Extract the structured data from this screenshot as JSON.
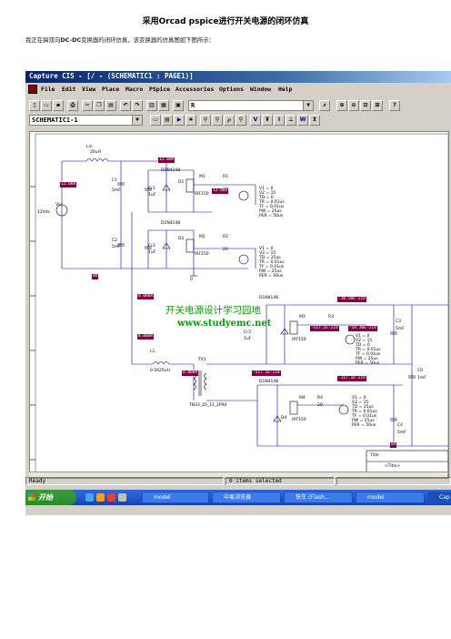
{
  "document": {
    "title": "采用Orcad pspice进行开关电源的闭环仿真",
    "intro_prefix": "我正在搞双向",
    "intro_bold": "DC-DC",
    "intro_suffix": "变换器的闭环仿真，该变换器的仿真图如下图所示："
  },
  "window": {
    "title": "Capture CIS - [/ - (SCHEMATIC1 : PAGE1)]"
  },
  "menu": [
    "File",
    "Edit",
    "View",
    "Place",
    "Macro",
    "PSpice",
    "Accessories",
    "Options",
    "Window",
    "Help"
  ],
  "toolbar": {
    "part_combo_value": "R",
    "schematic_combo_value": "SCHEMATIC1-1"
  },
  "schematic": {
    "labels": {
      "lin": "Lin",
      "lin_val": "20uH",
      "vin": "Vin",
      "vin_val": "12Vdc",
      "c1": "C1",
      "c1_val": "5mF",
      "c2": "C2",
      "c2_val": "5mF",
      "cr1": "Cr1",
      "cr1_val": "1uF",
      "cr2": "Cr2",
      "cr2_val": "1uF",
      "d1": "D1",
      "d2": "D2",
      "d1n1": "D1N4148",
      "d1n2": "D1N4148",
      "m1": "M1",
      "m1_part": "IRF150",
      "m2": "M2",
      "m2_part": "IRF150",
      "r1": "R1",
      "r1_val": "20",
      "r2": "R2",
      "r2_val": "20",
      "v1_params": [
        "V1 = 0",
        "V2 = 15",
        "TD = 0",
        "TR = 0.01us",
        "TF = 0.01us",
        "PW = 25us",
        "PER = 50us"
      ],
      "v2_params": [
        "V1 = 0",
        "V2 = 15",
        "TD = 25us",
        "TR = 0.01us",
        "TF = 0.01us",
        "PW = 25us",
        "PER = 50us"
      ],
      "l1": "L1",
      "l1_val": "0.5625uH",
      "tx1": "TX1",
      "tx_part": "TN33_20_11_2P90",
      "d3_part": "D1N4148",
      "m3": "M3",
      "m3_part": "IRF150",
      "r3": "R3",
      "c3": "C3",
      "c3_val": "5mF",
      "cr3": "Cr3",
      "cr3_val": "1uF",
      "v3_params": [
        "V1 = 0",
        "V2 = 15",
        "TD = 0",
        "TR = 0.01us",
        "TF = 0.01us",
        "PW = 25us",
        "PER = 50us"
      ],
      "d4_part": "D1N4148",
      "d4": "D4",
      "m4": "M4",
      "m4_part": "IRF150",
      "r4": "R4",
      "r4_val": "20",
      "c4": "C4",
      "c4_val": "5mF",
      "v4_params": [
        "V1 = 0",
        "V2 = 15",
        "TD = 25us",
        "TR = 0.01us",
        "TF = 0.01us",
        "PW = 25us",
        "PER = 50us"
      ],
      "c0": "C0",
      "c0_val": "1mF",
      "ground": "0",
      "title_block_title": "Title",
      "title_block_value": "<Title>"
    },
    "readouts": {
      "r_12v_a": "12.00V",
      "r_12v_b": "12.00V",
      "r_12v_c": "12.00V",
      "r_0v": "0V",
      "r_0v_bot": "0V",
      "r_0a": "0.000A",
      "r_0a_2": "0.000A",
      "r_tx": "0.000V",
      "r_top_right": "-10.50E-21V",
      "r_mid_a": "-517.1E-21V",
      "r_mid_b": "-54.30E-21V",
      "r_mid_c": "-517.1E-21V",
      "r_low": "-117.1E-21V"
    },
    "watermark_cn": "开关电源设计学习园地",
    "watermark_url": "www.studyemc.net"
  },
  "status": {
    "left": "Ready",
    "middle": "0 items selected"
  },
  "taskbar": {
    "start": "开始",
    "tasks": [
      "model",
      "中易浏览器",
      "快车 (Flash...",
      "model",
      "Cap"
    ]
  }
}
